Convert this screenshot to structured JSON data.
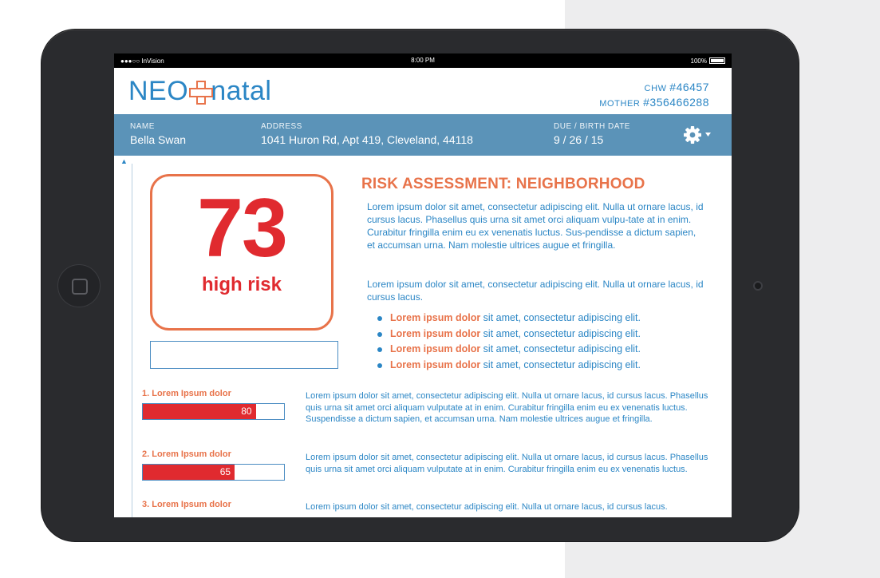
{
  "status_bar": {
    "carrier": "●●●○○ InVision",
    "time": "8:00 PM",
    "battery": "100%"
  },
  "header": {
    "logo_neo": "NEO",
    "logo_natal": "natal",
    "chw_label": "CHW ",
    "chw_value": "#46457",
    "mother_label": "MOTHER ",
    "mother_value": "#356466288"
  },
  "patient": {
    "name_label": "NAME",
    "name": "Bella Swan",
    "address_label": "ADDRESS",
    "address": "1041 Huron Rd, Apt 419, Cleveland, 44118",
    "date_label": "DUE / BIRTH DATE",
    "date": "9 / 26 / 15"
  },
  "score": {
    "value": "73",
    "label": "high risk"
  },
  "assessment": {
    "title": "RISK ASSESSMENT: NEIGHBORHOOD",
    "para1": "Lorem ipsum dolor sit amet, consectetur adipiscing elit. Nulla ut ornare lacus, id cursus lacus. Phasellus quis urna sit amet orci aliquam vulpu-tate at in enim. Curabitur fringilla enim eu ex venenatis luctus. Sus-pendisse a dictum sapien, et accumsan urna. Nam molestie ultrices augue et fringilla.",
    "para2": "Lorem ipsum dolor sit amet, consectetur adipiscing elit. Nulla ut ornare lacus, id cursus lacus.",
    "bullets": [
      {
        "bold": "Lorem ipsum dolor",
        "text": " sit amet, consectetur adipiscing elit."
      },
      {
        "bold": "Lorem ipsum dolor",
        "text": " sit amet, consectetur adipiscing elit."
      },
      {
        "bold": "Lorem ipsum dolor",
        "text": " sit amet, consectetur adipiscing elit."
      },
      {
        "bold": "Lorem ipsum dolor",
        "text": " sit amet, consectetur adipiscing elit."
      }
    ]
  },
  "factors": [
    {
      "title": "1. Lorem Ipsum dolor",
      "value": 80,
      "value_label": "80",
      "desc": "Lorem ipsum dolor sit amet, consectetur adipiscing elit. Nulla ut ornare lacus, id cursus lacus. Phasellus quis urna sit amet orci aliquam vulputate at in enim. Curabitur fringilla enim eu ex venenatis luctus. Suspendisse a dictum sapien, et accumsan urna. Nam molestie ultrices augue et fringilla."
    },
    {
      "title": "2. Lorem Ipsum dolor",
      "value": 65,
      "value_label": "65",
      "desc": "Lorem ipsum dolor sit amet, consectetur adipiscing elit. Nulla ut ornare lacus, id cursus lacus. Phasellus quis urna sit amet orci aliquam vulputate at in enim. Curabitur fringilla enim eu ex venenatis luctus."
    },
    {
      "title": "3. Lorem Ipsum dolor",
      "value": null,
      "value_label": "",
      "desc": "Lorem ipsum dolor sit amet, consectetur adipiscing elit. Nulla ut ornare lacus, id cursus lacus."
    }
  ],
  "colors": {
    "brand_blue": "#2b86c5",
    "accent_orange": "#e8734a",
    "risk_red": "#e02a2f",
    "info_bar": "#5b93b8"
  },
  "icons": {
    "settings": "gear-icon",
    "dropdown": "caret-down-icon",
    "scroll_up": "up-arrow-icon"
  }
}
